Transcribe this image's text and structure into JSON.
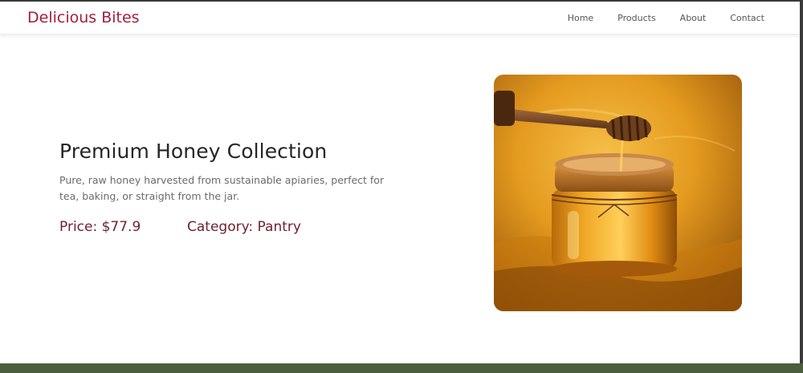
{
  "navbar": {
    "brand": "Delicious Bites",
    "links": [
      "Home",
      "Products",
      "About",
      "Contact"
    ]
  },
  "product": {
    "title": "Premium Honey Collection",
    "description": "Pure, raw honey harvested from sustainable apiaries, perfect for tea, baking, or straight from the jar.",
    "price_label": "Price: $77.9",
    "category_label": "Category: Pantry",
    "image_icon": "honey-jar-photo"
  },
  "colors": {
    "brand": "#a31f3d",
    "meta": "#6e1f2f",
    "footer": "#4b5e3d"
  }
}
